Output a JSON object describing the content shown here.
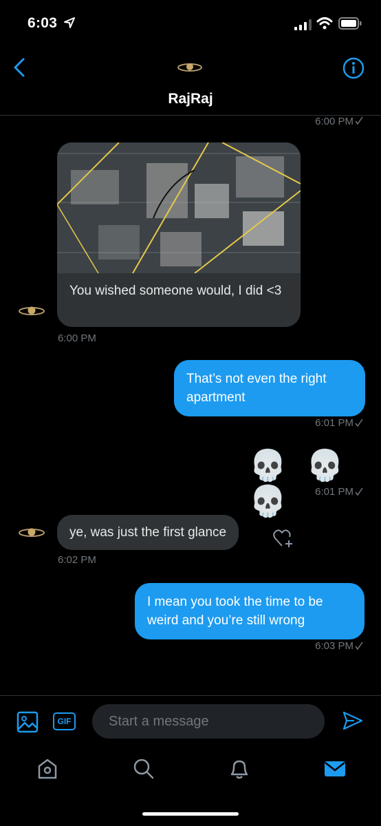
{
  "status_bar": {
    "time": "6:03"
  },
  "header": {
    "contact_name": "RajRaj"
  },
  "previous": {
    "timestamp": "6:00 PM"
  },
  "messages": [
    {
      "direction": "incoming",
      "type": "image",
      "caption": "You wished someone would, I did <3",
      "timestamp": "6:00 PM"
    },
    {
      "direction": "outgoing",
      "text": "That’s not even the right apartment",
      "timestamp": "6:01 PM"
    },
    {
      "direction": "outgoing",
      "text": "💀 💀 💀",
      "timestamp": "6:01 PM"
    },
    {
      "direction": "incoming",
      "text": "ye, was just the first glance",
      "timestamp": "6:02 PM"
    },
    {
      "direction": "outgoing",
      "text": "I mean you took the time to be weird and you’re still wrong",
      "timestamp": "6:03 PM"
    }
  ],
  "compose": {
    "placeholder": "Start a message",
    "gif_label": "GIF"
  },
  "icons": {
    "back": "chevron-left-icon",
    "info": "info-icon",
    "media": "image-icon",
    "send": "send-icon",
    "reaction": "heart-add-icon",
    "tabs": [
      "home-icon",
      "search-icon",
      "bell-icon",
      "mail-icon"
    ]
  },
  "colors": {
    "accent": "#1d9bf0",
    "incoming_bubble": "#2f3336",
    "background": "#000000",
    "muted": "#71767b"
  },
  "tabs": {
    "active": "messages"
  }
}
